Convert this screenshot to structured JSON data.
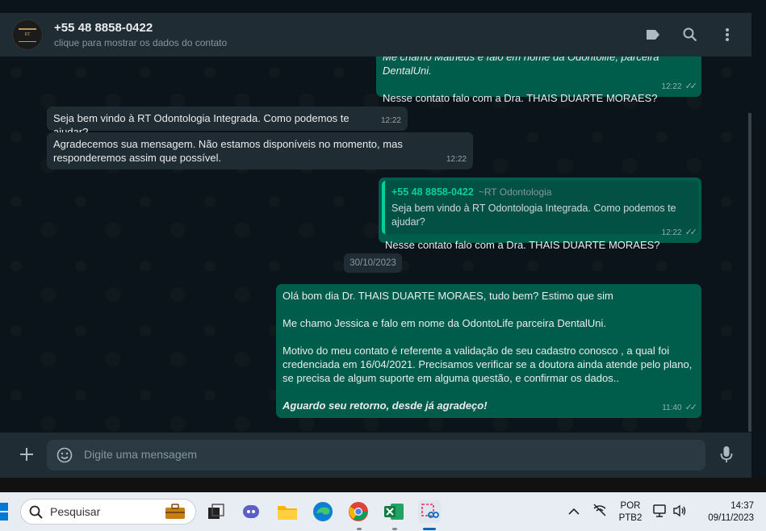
{
  "header": {
    "contact_name": "+55 48 8858-0422",
    "contact_subtitle": "clique para mostrar os dados do contato",
    "avatar_logo_text": "RT"
  },
  "messages": [
    {
      "direction": "out",
      "lines": [
        "Me chamo Matheus e falo em nome da Odontolife, parceira DentalUni.",
        "",
        "Nesse contato falo com a Dra. THAIS DUARTE MORAES?"
      ],
      "time": "12:22"
    },
    {
      "direction": "in",
      "text": "Seja bem vindo à RT Odontologia Integrada. Como podemos te ajudar?",
      "time": "12:22"
    },
    {
      "direction": "in",
      "text": "Agradecemos sua mensagem. Não estamos disponíveis no momento, mas responderemos assim que possível.",
      "time": "12:22"
    },
    {
      "direction": "out",
      "quote": {
        "name": "+55 48 8858-0422",
        "group": "~RT Odontologia",
        "text": "Seja bem vindo à RT Odontologia Integrada. Como podemos te ajudar?"
      },
      "text": "Nesse contato falo com a Dra. THAIS DUARTE MORAES?",
      "time": "12:22"
    },
    {
      "direction": "out",
      "p1": "Olá bom dia Dr. THAIS DUARTE MORAES, tudo bem? Estimo que sim",
      "p2": "Me chamo Jessica e falo em nome da OdontoLife parceira DentalUni.",
      "p3": "Motivo do meu contato é referente a validação de seu cadastro conosco , a qual foi credenciada em 16/04/2021. Precisamos verificar se a doutora ainda atende pelo plano, se precisa de algum suporte em alguma questão, e confirmar os dados..",
      "p4": "Aguardo seu retorno, desde já agradeço!",
      "time": "11:40"
    }
  ],
  "date_separator": "30/10/2023",
  "composer": {
    "placeholder": "Digite uma mensagem"
  },
  "taskbar": {
    "search_placeholder": "Pesquisar",
    "language_line1": "POR",
    "language_line2": "PTB2",
    "clock_time": "14:37",
    "clock_date": "09/11/2023",
    "apps": [
      "briefcase-icon",
      "task-view-icon",
      "teams-icon",
      "file-explorer-icon",
      "edge-icon",
      "chrome-icon",
      "excel-icon",
      "snipping-tool-icon"
    ]
  },
  "colors": {
    "chat_bg": "#0b141a",
    "header_bg": "#202c33",
    "outgoing_bubble": "#005c4b",
    "incoming_bubble": "#202c33",
    "accent": "#06cf9c"
  }
}
